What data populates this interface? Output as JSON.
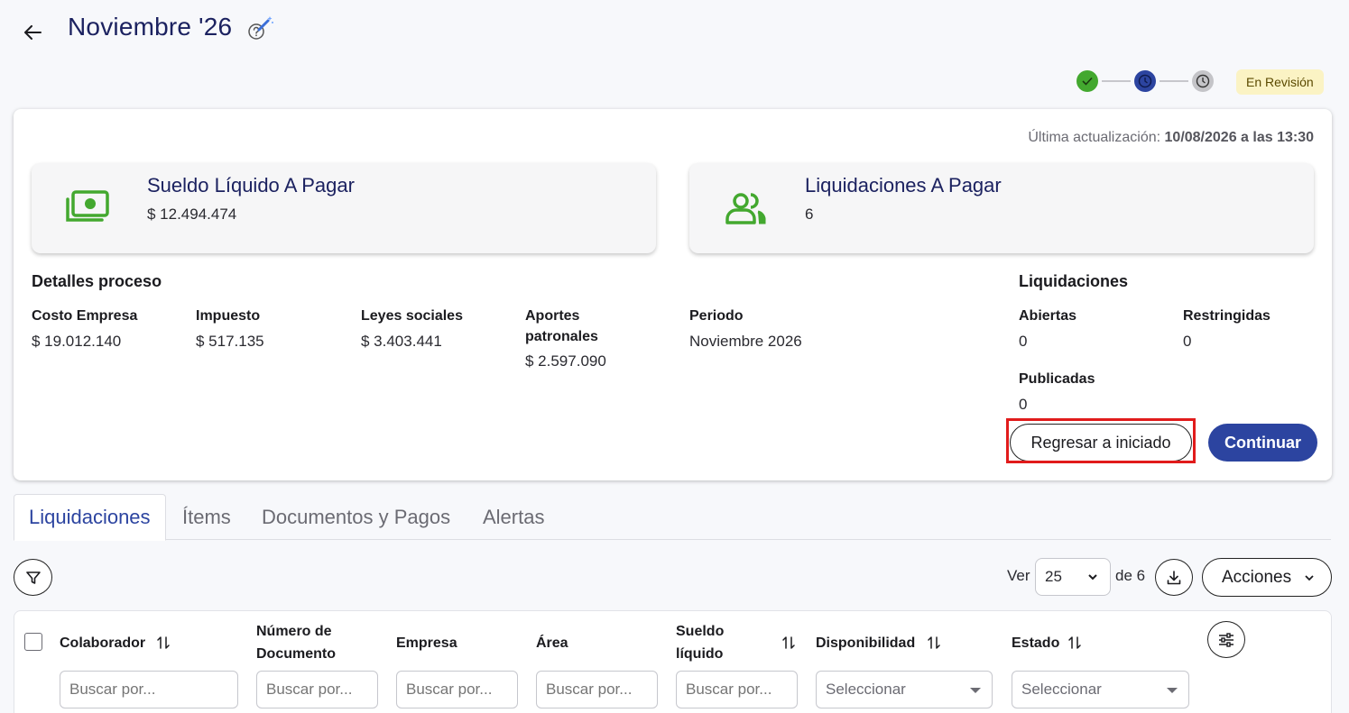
{
  "header": {
    "title": "Noviembre '26"
  },
  "status": {
    "badge": "En Revisión",
    "colors": {
      "done": "#43a82f",
      "current": "#2c44a0",
      "pending": "#9e9ea4"
    }
  },
  "summary": {
    "last_update_label": "Última actualización:",
    "last_update_value": "10/08/2026 a las 13:30",
    "kpis": [
      {
        "title": "Sueldo Líquido A Pagar",
        "value": "$ 12.494.474",
        "icon": "cash-icon"
      },
      {
        "title": "Liquidaciones A Pagar",
        "value": "6",
        "icon": "people-icon"
      }
    ],
    "details": {
      "title": "Detalles proceso",
      "fields": [
        {
          "label": "Costo Empresa",
          "value": "$ 19.012.140"
        },
        {
          "label": "Impuesto",
          "value": "$ 517.135"
        },
        {
          "label": "Leyes sociales",
          "value": "$ 3.403.441"
        },
        {
          "label": "Aportes patronales",
          "value": "$ 2.597.090"
        },
        {
          "label": "Periodo",
          "value": "Noviembre 2026"
        }
      ]
    },
    "liquidaciones": {
      "title": "Liquidaciones",
      "fields": [
        {
          "label": "Abiertas",
          "value": "0"
        },
        {
          "label": "Restringidas",
          "value": "0"
        },
        {
          "label": "Publicadas",
          "value": "0"
        }
      ]
    },
    "actions": {
      "back_label": "Regresar a iniciado",
      "continue_label": "Continuar"
    }
  },
  "tabs": [
    {
      "label": "Liquidaciones",
      "active": true
    },
    {
      "label": "Ítems",
      "active": false
    },
    {
      "label": "Documentos y Pagos",
      "active": false
    },
    {
      "label": "Alertas",
      "active": false
    }
  ],
  "toolbar": {
    "ver_label": "Ver",
    "page_size": "25",
    "of_label": "de 6",
    "actions_label": "Acciones"
  },
  "table": {
    "columns": [
      {
        "label": "Colaborador",
        "filter": "input",
        "placeholder": "Buscar por..."
      },
      {
        "label": "Número de Documento",
        "filter": "input",
        "placeholder": "Buscar por..."
      },
      {
        "label": "Empresa",
        "filter": "input",
        "placeholder": "Buscar por..."
      },
      {
        "label": "Área",
        "filter": "input",
        "placeholder": "Buscar por..."
      },
      {
        "label": "Sueldo líquido",
        "filter": "input",
        "placeholder": "Buscar por..."
      },
      {
        "label": "Disponibilidad",
        "filter": "select",
        "placeholder": "Seleccionar"
      },
      {
        "label": "Estado",
        "filter": "select",
        "placeholder": "Seleccionar"
      }
    ]
  }
}
